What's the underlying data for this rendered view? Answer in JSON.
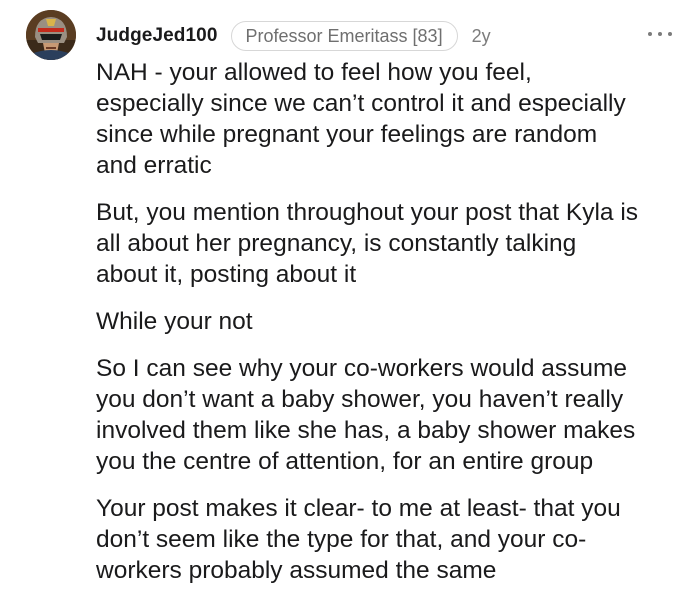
{
  "comment": {
    "username": "JudgeJed100",
    "flair": "Professor Emeritass [83]",
    "age": "2y",
    "avatar_icon": "judge-helmet-avatar-icon",
    "more_icon": "more-options-icon",
    "paragraphs": [
      {
        "lines": [
          "NAH - your allowed to feel how you feel,",
          "especially since we can’t control it and especially",
          "since while pregnant your feelings are random",
          "and erratic"
        ]
      },
      {
        "lines": [
          "But, you mention throughout your post that Kyla is",
          "all about her pregnancy, is constantly talking",
          "about it, posting about it"
        ]
      },
      {
        "lines": [
          "While your not"
        ]
      },
      {
        "lines": [
          "So I can see why your co-workers would assume",
          "you don’t want a baby shower, you haven’t really",
          "involved them like she has, a baby shower makes",
          "you the centre of attention, for an entire group"
        ]
      },
      {
        "lines": [
          "Your post makes it clear- to me at least- that you",
          "don’t seem like the type for that, and your co-",
          "workers probably assumed the same"
        ]
      }
    ]
  }
}
